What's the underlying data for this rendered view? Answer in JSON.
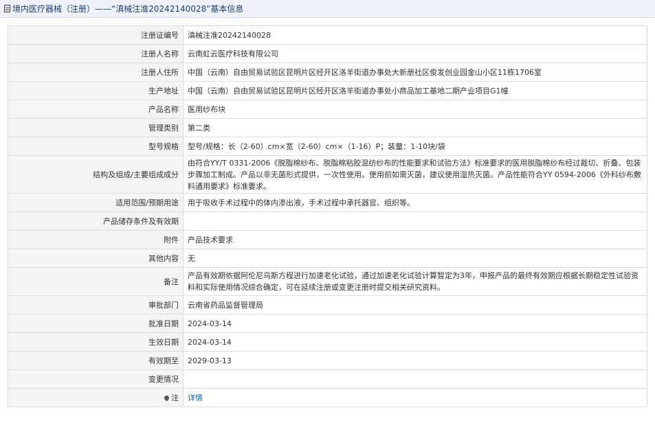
{
  "header": {
    "title": "境内医疗器械（注册）——“滇械注准20242140028”基本信息"
  },
  "rows": [
    {
      "label": "注册证编号",
      "value": "滇械注准20242140028"
    },
    {
      "label": "注册人名称",
      "value": "云南虹云医疗科技有限公司"
    },
    {
      "label": "注册人住所",
      "value": "中国（云南）自由贸易试验区昆明片区经开区洛羊街道办事处大新册社区俊发创业园金山小区11栋1706室"
    },
    {
      "label": "生产地址",
      "value": "中国（云南）自由贸易试验区昆明片区经开区洛羊街道办事处小商品加工基地二期产业项目G1幢"
    },
    {
      "label": "产品名称",
      "value": "医用纱布块"
    },
    {
      "label": "管理类别",
      "value": "第二类"
    },
    {
      "label": "型号规格",
      "value": "型号/规格：长（2-60）cm×宽（2-60）cm×（1-16）P；装量：1-10块/袋"
    },
    {
      "label": "结构及组成/主要组成成分",
      "value": "由符合YY/T 0331-2006《脱脂棉纱布、脱脂棉粘胶混纺纱布的性能要求和试验方法》标准要求的医用脱脂棉纱布经过裁切、折叠、包装步骤加工制成。产品以非无菌形式提供，一次性使用。使用前如需灭菌，建议使用湿热灭菌。产品性能符合YY 0594-2006《外科纱布敷料通用要求》标准要求。"
    },
    {
      "label": "适用范围/预期用途",
      "value": "用于吸收手术过程中的体内渗出液，手术过程中承托器官、组织等。"
    },
    {
      "label": "产品储存条件及有效期",
      "value": ""
    },
    {
      "label": "附件",
      "value": "产品技术要求"
    },
    {
      "label": "其他内容",
      "value": "无"
    },
    {
      "label": "备注",
      "value": "产品有效期依据阿伦尼乌斯方程进行加速老化试验，通过加速老化试验计算暂定为3年，申报产品的最终有效期应根据长期稳定性试验资料和实际使用情况综合确定，可在延续注册或变更注册时提交相关研究资料。"
    },
    {
      "label": "审批部门",
      "value": "云南省药品监督管理局"
    },
    {
      "label": "批准日期",
      "value": "2024-03-14"
    },
    {
      "label": "生效日期",
      "value": "2024-03-14"
    },
    {
      "label": "有效期至",
      "value": "2029-03-13"
    },
    {
      "label": "变更情况",
      "value": ""
    }
  ],
  "note": {
    "label": "注",
    "link_text": "详情"
  }
}
